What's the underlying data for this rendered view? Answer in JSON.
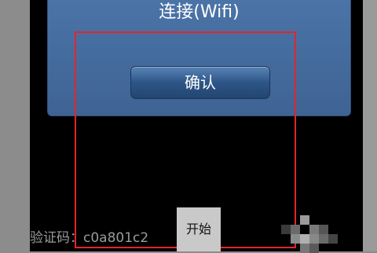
{
  "dialog": {
    "message": "连接(Wifi)",
    "confirm_label": "确认"
  },
  "bottom": {
    "start_label": "开始",
    "captcha_text": "验证码：c0a801c2"
  }
}
